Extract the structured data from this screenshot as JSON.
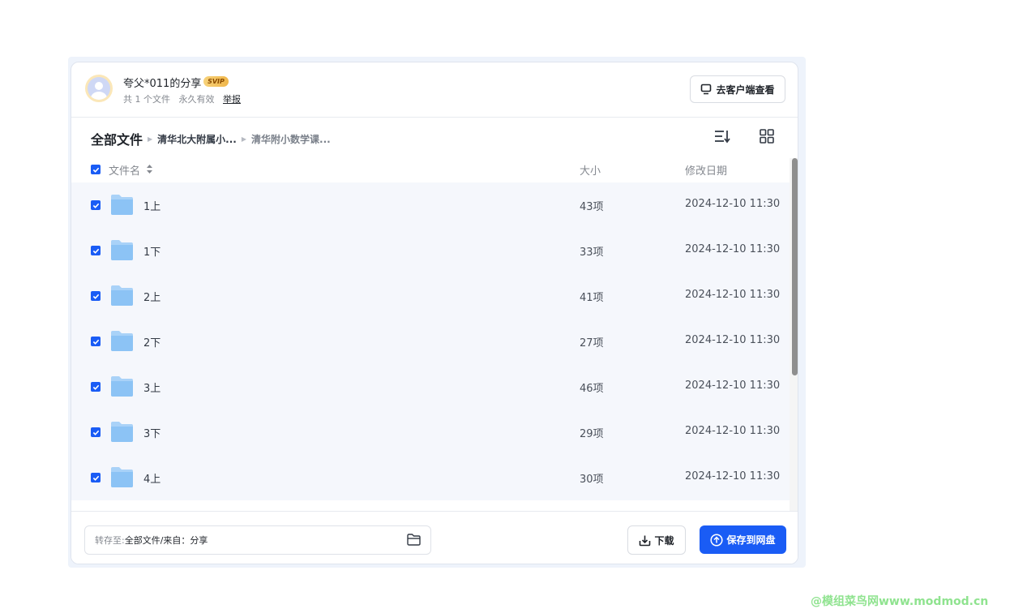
{
  "header": {
    "sharer": "夸父*011的分享",
    "badge": "SVIP",
    "file_count": "共 1 个文件",
    "validity": "永久有效",
    "report": "举报",
    "client_button": "去客户端查看"
  },
  "breadcrumb": {
    "root": "全部文件",
    "level1": "清华北大附属小...",
    "level2": "清华附小数学课..."
  },
  "table": {
    "col_name": "文件名",
    "col_size": "大小",
    "col_date": "修改日期",
    "rows": [
      {
        "name": "1上",
        "size": "43项",
        "date": "2024-12-10 11:30"
      },
      {
        "name": "1下",
        "size": "33项",
        "date": "2024-12-10 11:30"
      },
      {
        "name": "2上",
        "size": "41项",
        "date": "2024-12-10 11:30"
      },
      {
        "name": "2下",
        "size": "27项",
        "date": "2024-12-10 11:30"
      },
      {
        "name": "3上",
        "size": "46项",
        "date": "2024-12-10 11:30"
      },
      {
        "name": "3下",
        "size": "29项",
        "date": "2024-12-10 11:30"
      },
      {
        "name": "4上",
        "size": "30项",
        "date": "2024-12-10 11:30"
      }
    ]
  },
  "footer": {
    "saveto_label": "转存至:",
    "saveto_path": "全部文件/来自：分享",
    "download_button": "下载",
    "save_button": "保存到网盘"
  },
  "watermark": "@模组菜鸟网www.modmod.cn",
  "colors": {
    "accent": "#1a5cf5",
    "row_bg": "#f5f7fc",
    "folder": "#8cc3f5"
  }
}
